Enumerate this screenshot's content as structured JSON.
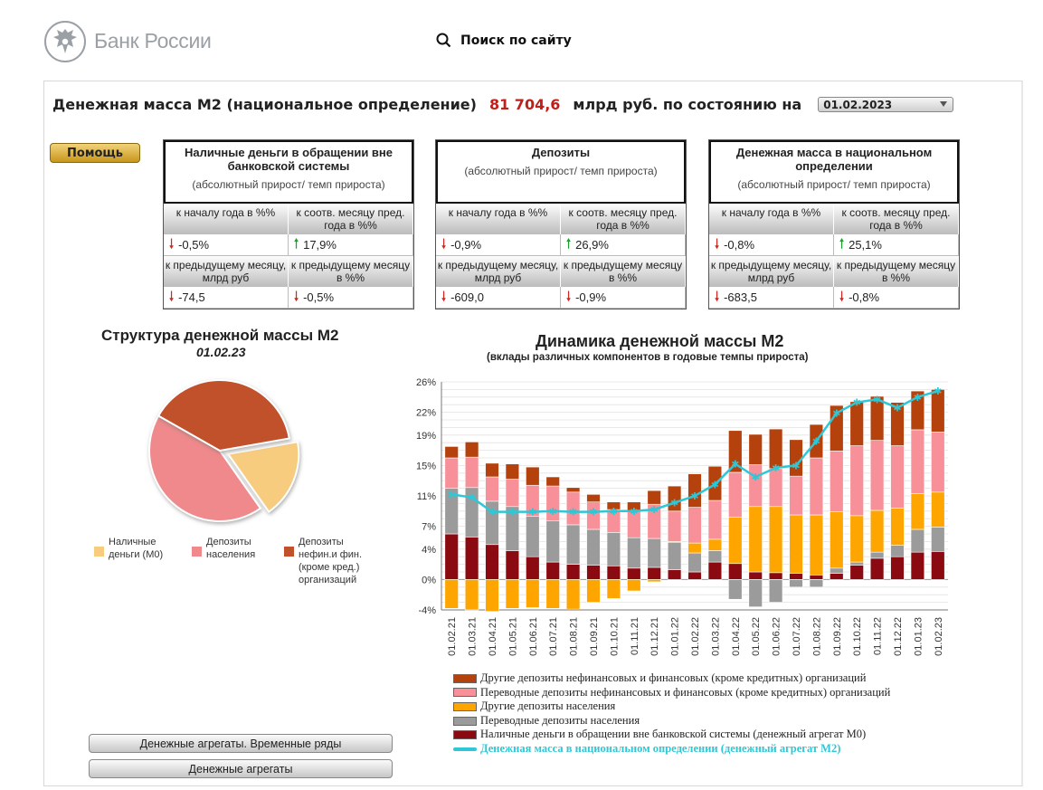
{
  "header": {
    "bank_name": "Банк России",
    "search_label": "Поиск по сайту"
  },
  "headline": {
    "prefix": "Денежная масса М2 (национальное определение)",
    "value": "81 704,6",
    "suffix": "млрд руб. по состоянию на",
    "selected_date": "01.02.2023"
  },
  "help_label": "Помощь",
  "cards": [
    {
      "title": "Наличные деньги в обращении вне банковской системы",
      "subtitle": "(абсолютный прирост/ темп прироста)",
      "h1": "к началу года в %%",
      "h2": "к соотв. месяцу пред. года в %%",
      "v1": "-0,5%",
      "v2": "17,9%",
      "h3": "к предыдущему месяцу, млрд руб",
      "h4": "к предыдущему месяцу в %%",
      "v3": "-74,5",
      "v4": "-0,5%"
    },
    {
      "title": "Депозиты",
      "subtitle": "(абсолютный прирост/ темп прироста)",
      "h1": "к началу года в %%",
      "h2": "к соотв. месяцу пред. года в %%",
      "v1": "-0,9%",
      "v2": "26,9%",
      "h3": "к предыдущему месяцу, млрд руб",
      "h4": "к предыдущему месяцу в %%",
      "v3": "-609,0",
      "v4": "-0,9%"
    },
    {
      "title": "Денежная масса в национальном определении",
      "subtitle": "(абсолютный прирост/ темп прироста)",
      "h1": "к началу года в %%",
      "h2": "к соотв. месяцу пред. года в %%",
      "v1": "-0,8%",
      "v2": "25,1%",
      "h3": "к предыдущему месяцу, млрд руб",
      "h4": "к предыдущему месяцу в %%",
      "v3": "-683,5",
      "v4": "-0,8%"
    }
  ],
  "icons": {
    "up": "arrow-up-icon",
    "down": "arrow-down-icon",
    "search": "search-icon",
    "logo": "eagle-emblem-icon"
  },
  "colors": {
    "accent_red": "#c0201a",
    "up": "#1e9e2e",
    "down": "#d0281e",
    "help_gold": "#d9a93a"
  },
  "bottom_buttons": [
    "Денежные агрегаты. Временные ряды",
    "Денежные агрегаты"
  ],
  "chart_data": [
    {
      "type": "pie",
      "title": "Структура денежной массы М2",
      "subtitle": "01.02.23",
      "slices": [
        {
          "label": "Наличные деньги (М0)",
          "value": 18,
          "color": "#f7cc7e",
          "exploded": true
        },
        {
          "label": "Депозиты населения",
          "value": 43,
          "color": "#f0898b"
        },
        {
          "label": "Депозиты нефин.и фин. (кроме кред.) организаций",
          "value": 39,
          "color": "#c1512b"
        }
      ]
    },
    {
      "type": "bar",
      "stacked": true,
      "title": "Динамика денежной массы М2",
      "subtitle": "(вклады различных компонентов в годовые темпы прироста)",
      "ylim": [
        -4,
        26
      ],
      "yticks": [
        "-4%",
        "0%",
        "4%",
        "7%",
        "11%",
        "15%",
        "19%",
        "22%",
        "26%"
      ],
      "grid": true,
      "legend_position": "bottom",
      "categories": [
        "01.02.21",
        "01.03.21",
        "01.04.21",
        "01.05.21",
        "01.06.21",
        "01.07.21",
        "01.08.21",
        "01.09.21",
        "01.10.21",
        "01.11.21",
        "01.12.21",
        "01.01.22",
        "01.02.22",
        "01.03.22",
        "01.04.22",
        "01.05.22",
        "01.06.22",
        "01.07.22",
        "01.08.22",
        "01.09.22",
        "01.10.22",
        "01.11.22",
        "01.12.22",
        "01.01.23",
        "01.02.23"
      ],
      "series": [
        {
          "name": "Наличные деньги в обращении вне банковской системы (денежный агрегат М0)",
          "color": "#8b0a12",
          "values": [
            6.0,
            5.6,
            4.6,
            3.8,
            3.0,
            2.3,
            2.0,
            1.9,
            1.8,
            1.5,
            1.6,
            1.3,
            1.0,
            2.3,
            2.1,
            1.0,
            0.9,
            0.8,
            0.6,
            0.8,
            1.9,
            2.8,
            3.0,
            3.6,
            3.7
          ]
        },
        {
          "name": "Переводные депозиты населения",
          "color": "#9b9b9b",
          "values": [
            6.0,
            6.5,
            5.7,
            5.8,
            5.3,
            5.4,
            5.2,
            4.7,
            4.4,
            4.0,
            3.8,
            3.6,
            2.5,
            1.5,
            -2.6,
            -3.6,
            -3.0,
            -1.0,
            -1.0,
            0.7,
            0.4,
            0.8,
            1.5,
            3.0,
            3.2
          ]
        },
        {
          "name": "Другие депозиты населения",
          "color": "#ffa500",
          "values": [
            -3.8,
            -4.0,
            -4.2,
            -3.8,
            -3.7,
            -3.8,
            -3.9,
            -3.0,
            -2.5,
            -1.5,
            -0.3,
            0.1,
            1.3,
            1.5,
            6.1,
            8.6,
            8.7,
            7.7,
            7.9,
            7.4,
            6.1,
            5.5,
            4.9,
            4.7,
            4.6
          ]
        },
        {
          "name": "Переводные депозиты нефинансовых и финансовых (кроме кредитных) организаций",
          "color": "#f79099",
          "values": [
            4.0,
            4.0,
            3.2,
            3.6,
            4.1,
            4.6,
            4.3,
            3.6,
            3.0,
            3.5,
            4.5,
            4.0,
            4.7,
            5.1,
            5.9,
            5.5,
            5.0,
            5.1,
            7.5,
            8.0,
            9.2,
            9.2,
            8.2,
            8.4,
            7.9
          ]
        },
        {
          "name": "Другие депозиты нефинансовых и финансовых (кроме кредитных) организаций",
          "color": "#b5420d",
          "values": [
            1.5,
            2.0,
            1.8,
            2.0,
            2.4,
            1.2,
            0.6,
            1.0,
            1.0,
            1.2,
            1.8,
            3.3,
            4.4,
            4.5,
            5.5,
            4.0,
            5.2,
            4.8,
            4.4,
            6.0,
            5.8,
            5.8,
            5.7,
            5.1,
            5.6
          ]
        }
      ],
      "line": {
        "name": "Денежная масса в национальном определении (денежный агрегат М2)",
        "color": "#2ec7d6",
        "values": [
          11.2,
          10.8,
          8.9,
          8.9,
          8.9,
          9.0,
          8.9,
          8.9,
          9.0,
          9.0,
          9.2,
          10.1,
          11.0,
          12.5,
          15.2,
          13.5,
          14.7,
          15.0,
          18.2,
          21.9,
          23.3,
          23.7,
          22.6,
          24.0,
          24.8
        ]
      }
    }
  ]
}
